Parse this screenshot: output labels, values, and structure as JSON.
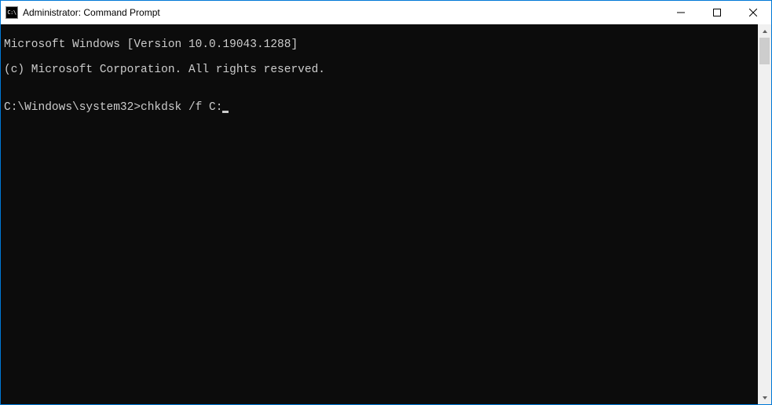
{
  "window": {
    "title": "Administrator: Command Prompt",
    "icon_label": "C:\\"
  },
  "terminal": {
    "line1": "Microsoft Windows [Version 10.0.19043.1288]",
    "line2": "(c) Microsoft Corporation. All rights reserved.",
    "blank": "",
    "prompt": "C:\\Windows\\system32>",
    "command": "chkdsk /f C:"
  }
}
